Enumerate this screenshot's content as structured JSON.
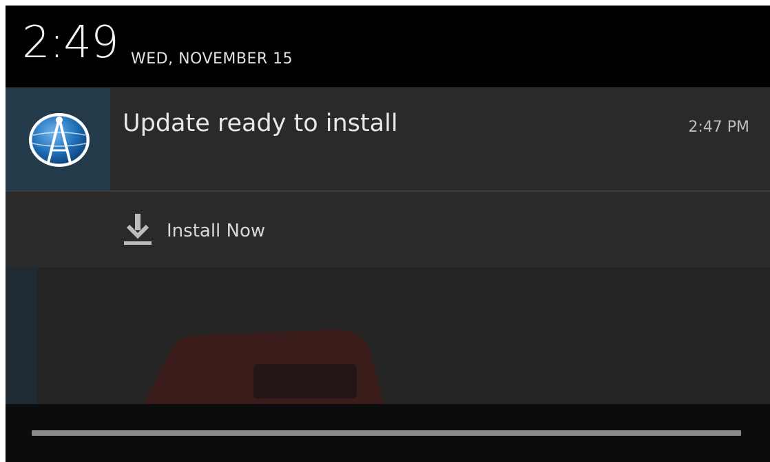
{
  "status_header": {
    "time": "2:49",
    "date": "WED, NOVEMBER 15"
  },
  "notification": {
    "app_icon": "compass-globe-icon",
    "title": "Update ready to install",
    "timestamp": "2:47 PM",
    "action": {
      "icon": "download-icon",
      "label": "Install Now"
    }
  },
  "background_app": {
    "image": "red-truck-illustration"
  },
  "colors": {
    "header_bg": "#000000",
    "card_bg": "#2a2a2a",
    "icon_bg": "#223a4a",
    "accent_blue": "#1f6fb8"
  }
}
